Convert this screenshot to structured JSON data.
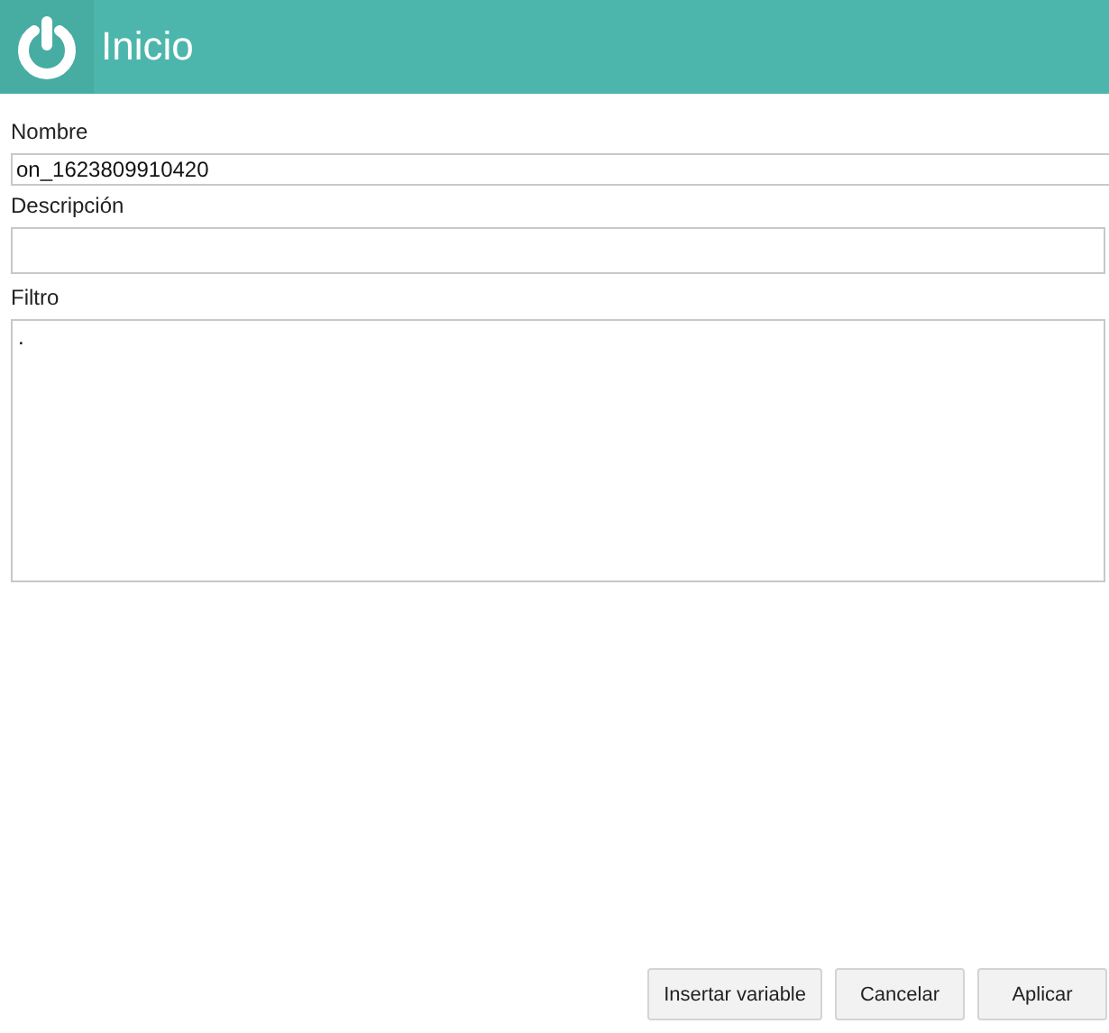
{
  "header": {
    "title": "Inicio"
  },
  "fields": [
    {
      "kind": "input",
      "label": "Nombre",
      "value": "on_1623809910420"
    },
    {
      "kind": "input",
      "label": "Descripción"
    },
    {
      "kind": "textarea",
      "label": "Filtro",
      "value": "."
    }
  ],
  "buttons": [
    "Insertar variable",
    "Cancelar",
    "Aplicar"
  ]
}
